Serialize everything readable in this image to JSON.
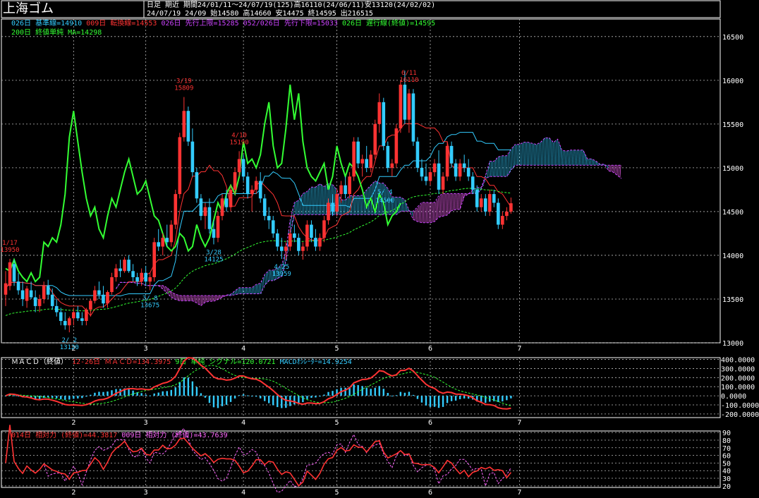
{
  "header": {
    "title": "上海ゴム",
    "line1": "日足 期近 期間24/01/11～24/07/19(125)高16110(24/06/11)安13120(24/02/02)",
    "line2": "24/07/19 24/09 始14580 高14660 安14475 終14595 出216515",
    "legend1": [
      {
        "text": "026日 基準線=14910",
        "color": "#33ccff"
      },
      {
        "text": "009日 転換線=14553",
        "color": "#ff3333"
      },
      {
        "text": "026日 先行上限=15285",
        "color": "#cc44ff"
      },
      {
        "text": "052/026日 先行下限=15033",
        "color": "#cc44ff"
      },
      {
        "text": "026日 遅行線(終値)=14595",
        "color": "#33ff33"
      }
    ],
    "legend2": [
      {
        "text": "200日 終値単純 MA=14298",
        "color": "#33ff33"
      }
    ]
  },
  "macd_legend": [
    {
      "text": "ＭＡＣＤ（終値）",
      "color": "#ffffff"
    },
    {
      "text": "12-26日 ＭＡＣＤ=134.3975",
      "color": "#ff3333"
    },
    {
      "text": "9日 単純 シグナル=120.0721",
      "color": "#33ff33"
    },
    {
      "text": "MACDｵｼﾚｰﾀｰ=14.9254",
      "color": "#33ccff"
    }
  ],
  "rsi_legend": [
    {
      "text": "014日 相対力 (終値)=44.3817",
      "color": "#ff3333"
    },
    {
      "text": "009日 相対力 (終値)=43.7639",
      "color": "#ff66ff"
    }
  ],
  "chart_data": [
    {
      "type": "candlestick",
      "ylim": [
        13000,
        16700
      ],
      "yticks": [
        13000,
        13500,
        14000,
        14500,
        15000,
        15500,
        16000,
        16500
      ],
      "xticks": [
        {
          "label": "2",
          "i": 16
        },
        {
          "label": "3",
          "i": 33
        },
        {
          "label": "4",
          "i": 56
        },
        {
          "label": "5",
          "i": 78
        },
        {
          "label": "6",
          "i": 100
        },
        {
          "label": "7",
          "i": 121
        }
      ],
      "ohlc": [
        [
          13550,
          13820,
          13420,
          13680
        ],
        [
          13650,
          13960,
          13600,
          13920
        ],
        [
          13900,
          13950,
          13650,
          13700
        ],
        [
          13700,
          13800,
          13550,
          13600
        ],
        [
          13600,
          13700,
          13420,
          13500
        ],
        [
          13480,
          13650,
          13400,
          13620
        ],
        [
          13600,
          13700,
          13500,
          13520
        ],
        [
          13520,
          13600,
          13350,
          13420
        ],
        [
          13420,
          13550,
          13350,
          13500
        ],
        [
          13500,
          13700,
          13450,
          13650
        ],
        [
          13650,
          13720,
          13500,
          13550
        ],
        [
          13550,
          13620,
          13380,
          13420
        ],
        [
          13420,
          13500,
          13300,
          13350
        ],
        [
          13350,
          13400,
          13200,
          13250
        ],
        [
          13250,
          13350,
          13150,
          13200
        ],
        [
          13200,
          13300,
          13120,
          13280
        ],
        [
          13280,
          13400,
          13200,
          13350
        ],
        [
          13350,
          13420,
          13250,
          13280
        ],
        [
          13280,
          13350,
          13200,
          13250
        ],
        [
          13250,
          13400,
          13200,
          13380
        ],
        [
          13380,
          13500,
          13300,
          13480
        ],
        [
          13480,
          13650,
          13450,
          13600
        ],
        [
          13600,
          13700,
          13500,
          13550
        ],
        [
          13550,
          13650,
          13400,
          13450
        ],
        [
          13450,
          13600,
          13400,
          13580
        ],
        [
          13580,
          13800,
          13550,
          13750
        ],
        [
          13750,
          13900,
          13700,
          13850
        ],
        [
          13850,
          13950,
          13750,
          13820
        ],
        [
          13820,
          13980,
          13800,
          13950
        ],
        [
          13950,
          14000,
          13800,
          13820
        ],
        [
          13820,
          13900,
          13700,
          13750
        ],
        [
          13750,
          13800,
          13650,
          13700
        ],
        [
          13700,
          13850,
          13650,
          13800
        ],
        [
          13800,
          13880,
          13650,
          13700
        ],
        [
          13700,
          13800,
          13600,
          13750
        ],
        [
          13750,
          14200,
          13700,
          14150
        ],
        [
          14150,
          14300,
          14050,
          14100
        ],
        [
          14100,
          14250,
          14000,
          14200
        ],
        [
          14200,
          14350,
          14100,
          14150
        ],
        [
          14150,
          14400,
          14100,
          14350
        ],
        [
          14350,
          14750,
          14300,
          14700
        ],
        [
          14700,
          15400,
          14650,
          15350
        ],
        [
          15350,
          15809,
          15300,
          15650
        ],
        [
          15650,
          15700,
          15250,
          15300
        ],
        [
          15300,
          15450,
          14900,
          14950
        ],
        [
          14950,
          15000,
          14600,
          14650
        ],
        [
          14650,
          14700,
          14400,
          14450
        ],
        [
          14450,
          14600,
          14300,
          14550
        ],
        [
          14550,
          14650,
          14250,
          14300
        ],
        [
          14300,
          14400,
          14125,
          14200
        ],
        [
          14200,
          14500,
          14150,
          14450
        ],
        [
          14450,
          14700,
          14400,
          14650
        ],
        [
          14650,
          14750,
          14500,
          14550
        ],
        [
          14550,
          14800,
          14500,
          14750
        ],
        [
          14750,
          15000,
          14700,
          14950
        ],
        [
          14950,
          15190,
          14900,
          15100
        ],
        [
          15100,
          15150,
          14850,
          14900
        ],
        [
          14900,
          14950,
          14650,
          14700
        ],
        [
          14700,
          14800,
          14500,
          14750
        ],
        [
          14750,
          14900,
          14700,
          14850
        ],
        [
          14850,
          14950,
          14600,
          14650
        ],
        [
          14650,
          14700,
          14400,
          14450
        ],
        [
          14450,
          14550,
          14300,
          14400
        ],
        [
          14400,
          14450,
          14200,
          14250
        ],
        [
          14250,
          14300,
          14050,
          14100
        ],
        [
          14100,
          14200,
          13959,
          14050
        ],
        [
          14050,
          14150,
          13950,
          14100
        ],
        [
          14100,
          14300,
          14050,
          14250
        ],
        [
          14250,
          14350,
          14150,
          14200
        ],
        [
          14200,
          14250,
          14000,
          14050
        ],
        [
          14050,
          14150,
          13950,
          14100
        ],
        [
          14100,
          14400,
          14050,
          14350
        ],
        [
          14350,
          14400,
          14150,
          14200
        ],
        [
          14200,
          14300,
          14050,
          14100
        ],
        [
          14100,
          14250,
          14050,
          14200
        ],
        [
          14200,
          14450,
          14150,
          14400
        ],
        [
          14400,
          14650,
          14350,
          14600
        ],
        [
          14600,
          14700,
          14450,
          14500
        ],
        [
          14500,
          14750,
          14450,
          14700
        ],
        [
          14700,
          14850,
          14600,
          14800
        ],
        [
          14800,
          14900,
          14650,
          14700
        ],
        [
          14700,
          14950,
          14650,
          14900
        ],
        [
          14900,
          15350,
          14850,
          15300
        ],
        [
          15300,
          15350,
          15000,
          15050
        ],
        [
          15050,
          15150,
          14900,
          15100
        ],
        [
          15100,
          15250,
          14950,
          15000
        ],
        [
          15000,
          15200,
          14950,
          15150
        ],
        [
          15150,
          15550,
          15100,
          15500
        ],
        [
          15500,
          15850,
          15400,
          15750
        ],
        [
          15750,
          15800,
          15200,
          15250
        ],
        [
          15250,
          15300,
          14950,
          15000
        ],
        [
          15000,
          15100,
          14900,
          15050
        ],
        [
          15050,
          15500,
          15000,
          15450
        ],
        [
          15450,
          16000,
          15400,
          15950
        ],
        [
          15950,
          16110,
          15500,
          15550
        ],
        [
          15550,
          15900,
          15400,
          15850
        ],
        [
          15850,
          15900,
          15250,
          15300
        ],
        [
          15300,
          15350,
          14950,
          15000
        ],
        [
          15000,
          15100,
          14850,
          14900
        ],
        [
          14900,
          15050,
          14800,
          14850
        ],
        [
          14850,
          15000,
          14800,
          14950
        ],
        [
          14950,
          15100,
          14900,
          15050
        ],
        [
          15050,
          15200,
          14700,
          14750
        ],
        [
          14750,
          14950,
          14700,
          14900
        ],
        [
          14900,
          15300,
          14850,
          15250
        ],
        [
          15250,
          15300,
          15000,
          15050
        ],
        [
          15050,
          15100,
          14850,
          14900
        ],
        [
          14900,
          15100,
          14850,
          15050
        ],
        [
          15050,
          15150,
          14950,
          15000
        ],
        [
          15000,
          15100,
          14850,
          14900
        ],
        [
          14900,
          14950,
          14700,
          14750
        ],
        [
          14750,
          14800,
          14500,
          14550
        ],
        [
          14550,
          14700,
          14500,
          14650
        ],
        [
          14650,
          14700,
          14450,
          14500
        ],
        [
          14500,
          14750,
          14450,
          14700
        ],
        [
          14700,
          14750,
          14550,
          14600
        ],
        [
          14600,
          14650,
          14300,
          14350
        ],
        [
          14350,
          14500,
          14300,
          14450
        ],
        [
          14450,
          14550,
          14400,
          14500
        ],
        [
          14500,
          14660,
          14475,
          14595
        ]
      ],
      "annotations": [
        {
          "i": 1,
          "date": "1/17",
          "value": "13950",
          "pos": "above",
          "color": "#ff3333"
        },
        {
          "i": 15,
          "date": "2/ 2",
          "value": "13120",
          "pos": "below",
          "color": "#33ccff"
        },
        {
          "i": 34,
          "date": "3/ 8",
          "value": "13675",
          "pos": "below",
          "color": "#33ccff"
        },
        {
          "i": 42,
          "date": "3/19",
          "value": "15809",
          "pos": "above",
          "color": "#ff3333"
        },
        {
          "i": 49,
          "date": "3/28",
          "value": "14125",
          "pos": "below",
          "color": "#33ccff"
        },
        {
          "i": 55,
          "date": "4/10",
          "value": "15190",
          "pos": "above",
          "color": "#ff3333"
        },
        {
          "i": 65,
          "date": "4/25",
          "value": "13959",
          "pos": "below",
          "color": "#33ccff"
        },
        {
          "i": 95,
          "date": "6/11",
          "value": "16110",
          "pos": "above",
          "color": "#ff3333"
        }
      ],
      "ichimoku_labels": [
        {
          "i": 88,
          "text": "5/ 4"
        },
        {
          "i": 88,
          "text": "14500"
        }
      ]
    },
    {
      "type": "macd",
      "ylim": [
        -240,
        420
      ],
      "yticks": [
        400,
        300,
        200,
        100,
        0,
        -100,
        -200
      ],
      "ytick_labels": [
        "400.0000",
        "300.0000",
        "200.0000",
        "100.0000",
        "0.0000",
        "-100.0000",
        "-200.0000"
      ]
    },
    {
      "type": "rsi",
      "ylim": [
        18,
        92
      ],
      "yticks": [
        90,
        80,
        70,
        60,
        50,
        40,
        30,
        20
      ]
    }
  ]
}
